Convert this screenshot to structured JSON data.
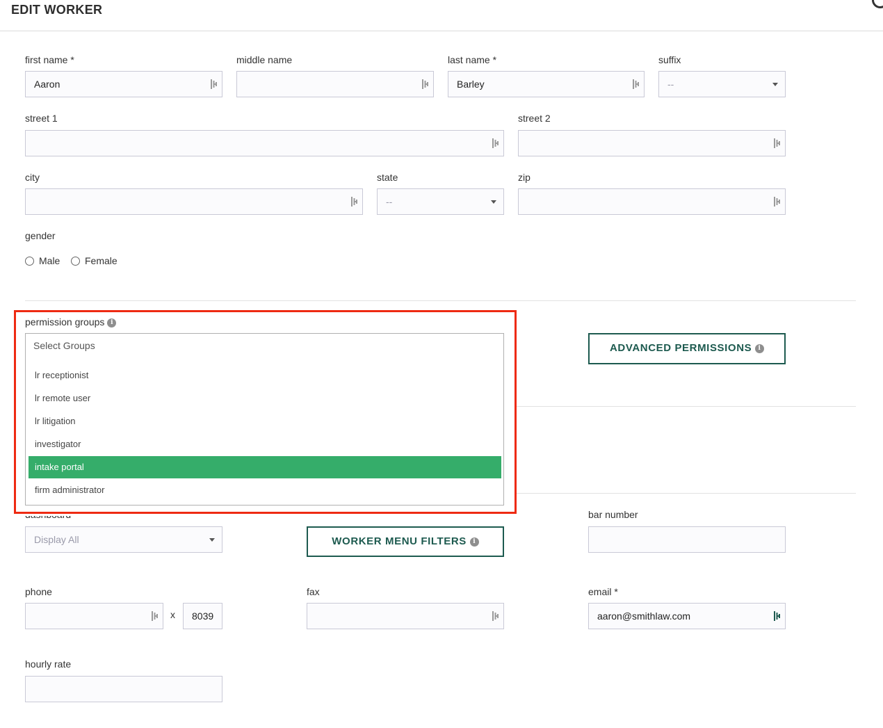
{
  "header": {
    "title": "EDIT WORKER"
  },
  "fields": {
    "first_name": {
      "label": "first name *",
      "value": "Aaron"
    },
    "middle_name": {
      "label": "middle name",
      "value": ""
    },
    "last_name": {
      "label": "last name *",
      "value": "Barley"
    },
    "suffix": {
      "label": "suffix",
      "value": "--"
    },
    "street1": {
      "label": "street 1",
      "value": ""
    },
    "street2": {
      "label": "street 2",
      "value": ""
    },
    "city": {
      "label": "city",
      "value": ""
    },
    "state": {
      "label": "state",
      "value": "--"
    },
    "zip": {
      "label": "zip",
      "value": ""
    },
    "gender": {
      "label": "gender",
      "options": [
        "Male",
        "Female"
      ]
    },
    "dashboard": {
      "label": "dashboard",
      "value": "Display All"
    },
    "bar_number": {
      "label": "bar number",
      "value": ""
    },
    "phone": {
      "label": "phone",
      "value": "",
      "ext_sep": "x",
      "ext_value": "8039"
    },
    "fax": {
      "label": "fax",
      "value": ""
    },
    "email": {
      "label": "email *",
      "value": "aaron@smithlaw.com"
    },
    "hourly_rate": {
      "label": "hourly rate",
      "value": ""
    }
  },
  "permission_groups": {
    "label": "permission groups",
    "placeholder": "Select Groups",
    "options": [
      "lr receptionist",
      "lr remote user",
      "lr litigation",
      "investigator",
      "intake portal",
      "firm administrator"
    ],
    "selected": "intake portal"
  },
  "buttons": {
    "advanced_permissions": "ADVANCED PERMISSIONS",
    "worker_menu_filters": "WORKER MENU FILTERS"
  },
  "icons": {
    "info": "info-icon",
    "keyboard": "keyboard-shortcut-icon",
    "dropdown": "chevron-down-icon"
  },
  "colors": {
    "accent": "#1d5a4f",
    "selected_option": "#35ad6a",
    "highlight_border": "#ee2a12"
  }
}
